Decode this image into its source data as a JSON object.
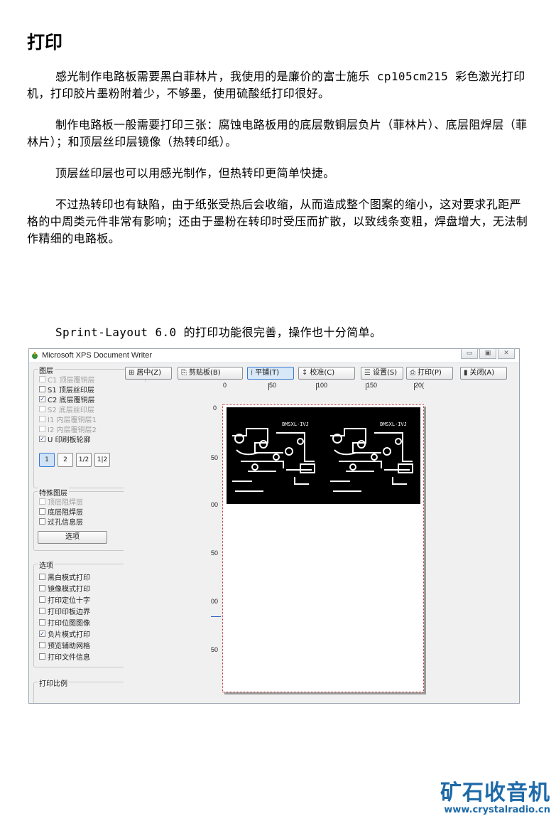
{
  "document": {
    "title": "打印",
    "paragraphs": [
      "感光制作电路板需要黑白菲林片，我使用的是廉价的富士施乐 cp105cm215 彩色激光打印机，打印胶片墨粉附着少，不够墨，使用硫酸纸打印很好。",
      "制作电路板一般需要打印三张：腐蚀电路板用的底层敷铜层负片（菲林片）、底层阻焊层（菲林片）；和顶层丝印层镜像（热转印纸）。",
      "顶层丝印层也可以用感光制作，但热转印更简单快捷。",
      "不过热转印也有缺陷，由于纸张受热后会收缩，从而造成整个图案的缩小，这对要求孔距严格的中周类元件非常有影响；还由于墨粉在转印时受压而扩散，以致线条变粗，焊盘增大，无法制作精细的电路板。",
      "Sprint-Layout 6.0 的打印功能很完善，操作也十分简单。"
    ]
  },
  "window": {
    "title": "Microsoft XPS Document Writer",
    "buttons": {
      "minimize": "▭",
      "maximize": "▣",
      "close": "✕"
    }
  },
  "layers_panel": {
    "label": "图层",
    "items": [
      {
        "label": "C1 顶层覆铜层",
        "checked": false,
        "enabled": false,
        "color": ""
      },
      {
        "label": "S1 顶层丝印层",
        "checked": false,
        "enabled": true,
        "color": "#4a1040"
      },
      {
        "label": "C2 底层覆铜层",
        "checked": true,
        "enabled": true,
        "color": "#000000"
      },
      {
        "label": "S2 底层丝印层",
        "checked": false,
        "enabled": false,
        "color": ""
      },
      {
        "label": "I1 内层覆铜层1",
        "checked": false,
        "enabled": false,
        "color": ""
      },
      {
        "label": "I2 内层覆铜层2",
        "checked": false,
        "enabled": false,
        "color": ""
      },
      {
        "label": "U 印刷板轮廓",
        "checked": true,
        "enabled": true,
        "color": "#000000"
      }
    ],
    "view_buttons": [
      "1",
      "2",
      "1/2",
      "1|2"
    ]
  },
  "special_layers": {
    "label": "特殊图层",
    "items": [
      {
        "label": "顶层阻焊层",
        "checked": false,
        "enabled": false,
        "color": ""
      },
      {
        "label": "底层阻焊层",
        "checked": false,
        "enabled": true,
        "color": "#000000"
      },
      {
        "label": "过孔信息层",
        "checked": false,
        "enabled": true,
        "color": "#000000"
      }
    ],
    "options_button": "选项"
  },
  "options_panel": {
    "label": "选项",
    "items": [
      {
        "label": "黑白模式打印",
        "checked": false
      },
      {
        "label": "镜像模式打印",
        "checked": false
      },
      {
        "label": "打印定位十字",
        "checked": false
      },
      {
        "label": "打印印板边界",
        "checked": false
      },
      {
        "label": "打印位图图像",
        "checked": false
      },
      {
        "label": "负片模式打印",
        "checked": true
      },
      {
        "label": "预览辅助网格",
        "checked": false
      },
      {
        "label": "打印文件信息",
        "checked": false
      }
    ]
  },
  "scale_panel": {
    "label": "打印比例"
  },
  "toolbar": {
    "center": "居中(Z)",
    "clipboard": "剪贴板(B)",
    "tile": "平铺(T)",
    "calibrate": "校准(C)",
    "settings": "设置(S)",
    "print": "打印(P)",
    "close": "关闭(A)",
    "help": "?"
  },
  "ruler": {
    "top": [
      "0",
      "50",
      "100",
      "150",
      "20("
    ],
    "left": [
      "0",
      "50",
      "00",
      "50",
      "00",
      "50"
    ]
  },
  "preview": {
    "board_label_1": "BMSXL-IVJ",
    "board_label_2": "BMSXL-IVJ"
  },
  "logo": {
    "text": "矿石收音机",
    "url": "www.crystalradio.cn",
    "color": "#1e6aa8"
  }
}
